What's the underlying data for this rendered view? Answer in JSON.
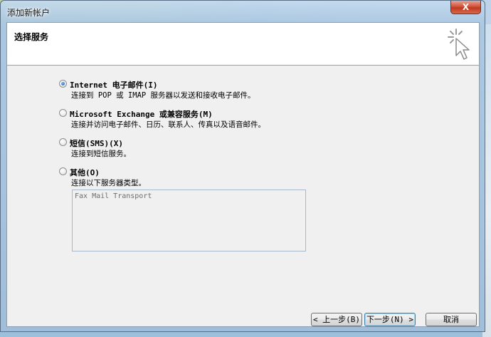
{
  "window": {
    "title": "添加新帐户",
    "close_label": "X"
  },
  "header": {
    "title": "选择服务"
  },
  "options": [
    {
      "label": "Internet 电子邮件(I)",
      "description": "连接到 POP 或 IMAP 服务器以发送和接收电子邮件。",
      "checked": true
    },
    {
      "label": "Microsoft Exchange 或兼容服务(M)",
      "description": "连接并访问电子邮件、日历、联系人、传真以及语音邮件。",
      "checked": false
    },
    {
      "label": "短信(SMS)(X)",
      "description": "连接到短信服务。",
      "checked": false
    },
    {
      "label": "其他(O)",
      "description": "连接以下服务器类型。",
      "checked": false
    }
  ],
  "service_list": {
    "items": [
      "Fax Mail Transport"
    ]
  },
  "buttons": {
    "back": "< 上一步(B)",
    "next": "下一步(N) >",
    "cancel": "取消"
  }
}
